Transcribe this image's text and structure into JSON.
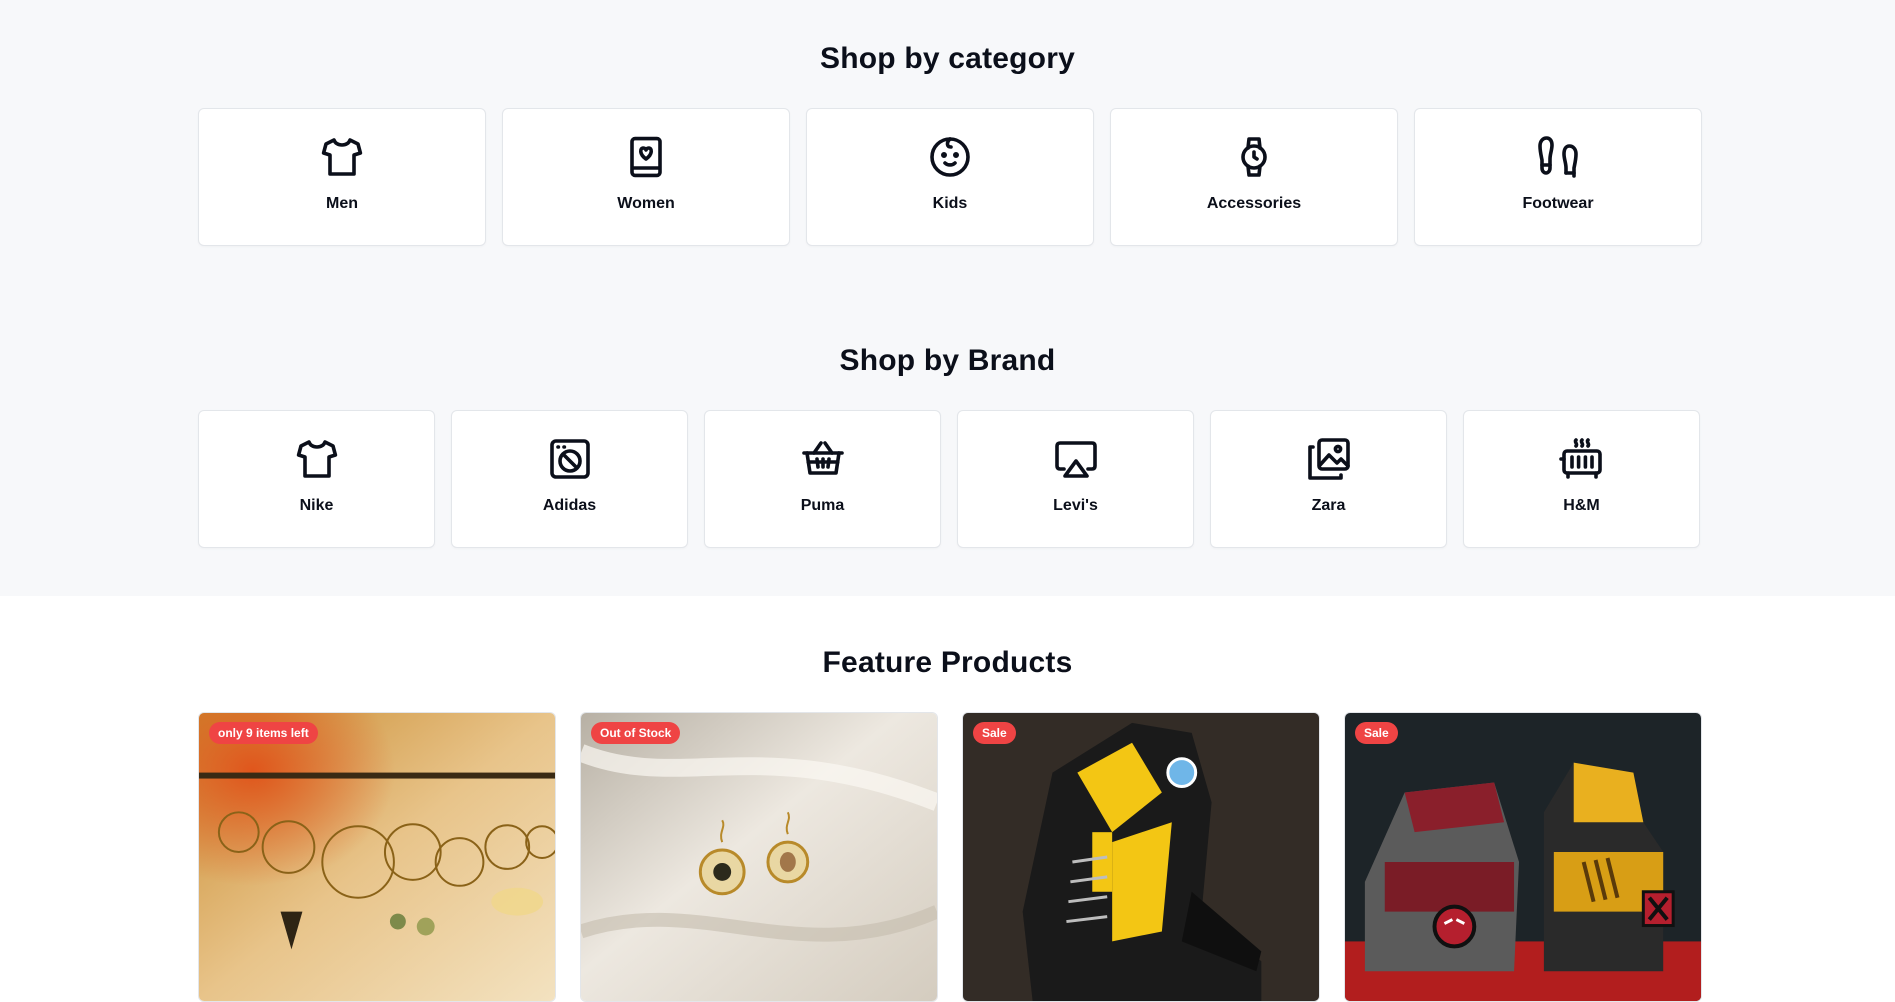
{
  "category_section": {
    "title": "Shop by category",
    "items": [
      {
        "label": "Men",
        "icon": "tshirt-icon"
      },
      {
        "label": "Women",
        "icon": "heart-book-icon"
      },
      {
        "label": "Kids",
        "icon": "baby-face-icon"
      },
      {
        "label": "Accessories",
        "icon": "watch-icon"
      },
      {
        "label": "Footwear",
        "icon": "footprints-icon"
      }
    ]
  },
  "brand_section": {
    "title": "Shop by Brand",
    "items": [
      {
        "label": "Nike",
        "icon": "tshirt-icon"
      },
      {
        "label": "Adidas",
        "icon": "washing-machine-icon"
      },
      {
        "label": "Puma",
        "icon": "basket-icon"
      },
      {
        "label": "Levi's",
        "icon": "airplay-icon"
      },
      {
        "label": "Zara",
        "icon": "image-gallery-icon"
      },
      {
        "label": "H&M",
        "icon": "heater-icon"
      }
    ]
  },
  "feature_section": {
    "title": "Feature Products",
    "products": [
      {
        "badge": "only 9 items left",
        "image": "earrings-display-photo"
      },
      {
        "badge": "Out of Stock",
        "image": "round-earrings-photo"
      },
      {
        "badge": "Sale",
        "image": "yellow-sneaker-photo"
      },
      {
        "badge": "Sale",
        "image": "red-yellow-sneakers-photo"
      }
    ]
  },
  "colors": {
    "page_bg": "#f7f8fa",
    "text": "#0b0f1a",
    "badge_bg": "#ef4444",
    "card_border": "#e3e6ea"
  }
}
